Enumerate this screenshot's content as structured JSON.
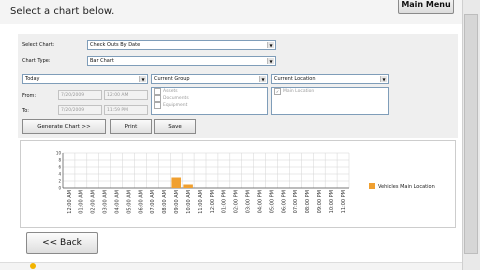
{
  "header": {
    "instruction": "Select a chart below.",
    "main_menu_label": "Main Menu"
  },
  "form": {
    "select_chart_label": "Select Chart:",
    "select_chart_value": "Check Outs By Date",
    "chart_type_label": "Chart Type:",
    "chart_type_value": "Bar Chart",
    "range_value": "Today",
    "from_label": "From:",
    "to_label": "To:",
    "from_date": "7/20/2009",
    "from_time": "12:00 AM",
    "to_date": "7/20/2009",
    "to_time": "11:59 PM",
    "group_dropdown": "Current Group",
    "group_items": [
      "Assets",
      "Documents",
      "Equipment"
    ],
    "location_dropdown": "Current Location",
    "location_items": [
      "Main Location"
    ],
    "generate_label": "Generate Chart >>",
    "print_label": "Print",
    "save_label": "Save"
  },
  "chart_data": {
    "type": "bar",
    "title": "",
    "xlabel": "",
    "ylabel": "",
    "ylim": [
      0,
      10
    ],
    "ytick_labels": [
      "10",
      "8",
      "6",
      "4",
      "2",
      "0"
    ],
    "categories": [
      "12:00 AM",
      "01:00 AM",
      "02:00 AM",
      "03:00 AM",
      "04:00 AM",
      "05:00 AM",
      "06:00 AM",
      "07:00 AM",
      "08:00 AM",
      "09:00 AM",
      "10:00 AM",
      "11:00 AM",
      "12:00 PM",
      "01:00 PM",
      "02:00 PM",
      "03:00 PM",
      "04:00 PM",
      "05:00 PM",
      "06:00 PM",
      "07:00 PM",
      "08:00 PM",
      "09:00 PM",
      "10:00 PM",
      "11:00 PM"
    ],
    "series": [
      {
        "name": "Vehicles Main Location",
        "color": "#f0a030",
        "values": [
          0,
          0,
          0,
          0,
          0,
          0,
          0,
          0,
          0,
          3,
          1,
          0,
          0,
          0,
          0,
          0,
          0,
          0,
          0,
          0,
          0,
          0,
          0,
          0
        ]
      }
    ],
    "grid": true,
    "legend_position": "right"
  },
  "footer": {
    "back_label": "<< Back"
  },
  "icons": {
    "status": "warning-icon",
    "dropdown": "chevron-down-icon"
  }
}
